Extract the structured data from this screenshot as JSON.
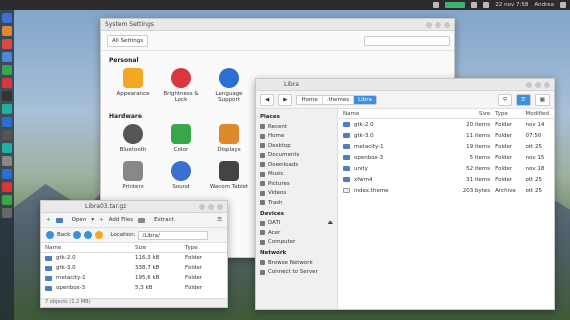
{
  "topbar": {
    "datetime": "22 nov  7:58",
    "user": "Andrea"
  },
  "settings": {
    "title": "System Settings",
    "all_settings": "All Settings",
    "sections": [
      {
        "label": "Personal",
        "items": [
          {
            "label": "Appearance",
            "icon": "appearance-icon",
            "color": "#f5a623"
          },
          {
            "label": "Brightness & Lock",
            "icon": "brightness-lock-icon",
            "color": "#d9363e"
          },
          {
            "label": "Language Support",
            "icon": "language-icon",
            "color": "#2a6fd1"
          }
        ]
      },
      {
        "label": "Hardware",
        "items": [
          {
            "label": "Bluetooth",
            "icon": "bluetooth-icon",
            "color": "#555555"
          },
          {
            "label": "Color",
            "icon": "color-icon",
            "color": "#37a84a"
          },
          {
            "label": "Displays",
            "icon": "displays-icon",
            "color": "#e0892c"
          },
          {
            "label": "Printers",
            "icon": "printer-icon",
            "color": "#888888"
          },
          {
            "label": "Sound",
            "icon": "sound-icon",
            "color": "#3b6fd1"
          },
          {
            "label": "Wacom Tablet",
            "icon": "wacom-icon",
            "color": "#444444"
          }
        ]
      }
    ]
  },
  "files": {
    "title": "Libra",
    "breadcrumb": [
      "Home",
      ".themes",
      "Libra"
    ],
    "sidebar": [
      {
        "header": "Places",
        "items": [
          "Recent",
          "Home",
          "Desktop",
          "Documents",
          "Downloads",
          "Music",
          "Pictures",
          "Videos",
          "Trash"
        ]
      },
      {
        "header": "Devices",
        "items": [
          "DATI",
          "Acer",
          "Computer"
        ]
      },
      {
        "header": "Network",
        "items": [
          "Browse Network",
          "Connect to Server"
        ]
      }
    ],
    "columns": {
      "name": "Name",
      "size": "Size",
      "type": "Type",
      "modified": "Modified"
    },
    "rows": [
      {
        "name": "gtk-2.0",
        "size": "20 items",
        "type": "Folder",
        "modified": "nov 14",
        "kind": "folder"
      },
      {
        "name": "gtk-3.0",
        "size": "11 items",
        "type": "Folder",
        "modified": "07:50",
        "kind": "folder"
      },
      {
        "name": "metacity-1",
        "size": "19 items",
        "type": "Folder",
        "modified": "ott 25",
        "kind": "folder"
      },
      {
        "name": "openbox-3",
        "size": "5 items",
        "type": "Folder",
        "modified": "nov 15",
        "kind": "folder"
      },
      {
        "name": "unity",
        "size": "52 items",
        "type": "Folder",
        "modified": "nov 18",
        "kind": "folder"
      },
      {
        "name": "xfwm4",
        "size": "31 items",
        "type": "Folder",
        "modified": "ott 25",
        "kind": "folder"
      },
      {
        "name": "index.theme",
        "size": "203 bytes",
        "type": "Archive",
        "modified": "ott 25",
        "kind": "file"
      }
    ]
  },
  "archive": {
    "title": "Libra03.tar.gz",
    "open": "Open",
    "add_files": "Add Files",
    "extract": "Extract",
    "back": "Back",
    "location_label": "Location:",
    "location_value": "/Libra/",
    "columns": {
      "name": "Name",
      "size": "Size",
      "type": "Type"
    },
    "rows": [
      {
        "name": "gtk-2.0",
        "size": "116,3 kB",
        "type": "Folder"
      },
      {
        "name": "gtk-3.0",
        "size": "338,7 kB",
        "type": "Folder"
      },
      {
        "name": "metacity-1",
        "size": "195,6 kB",
        "type": "Folder"
      },
      {
        "name": "openbox-3",
        "size": "5,3 kB",
        "type": "Folder"
      }
    ],
    "status": "7 objects (1,2 MB)"
  }
}
